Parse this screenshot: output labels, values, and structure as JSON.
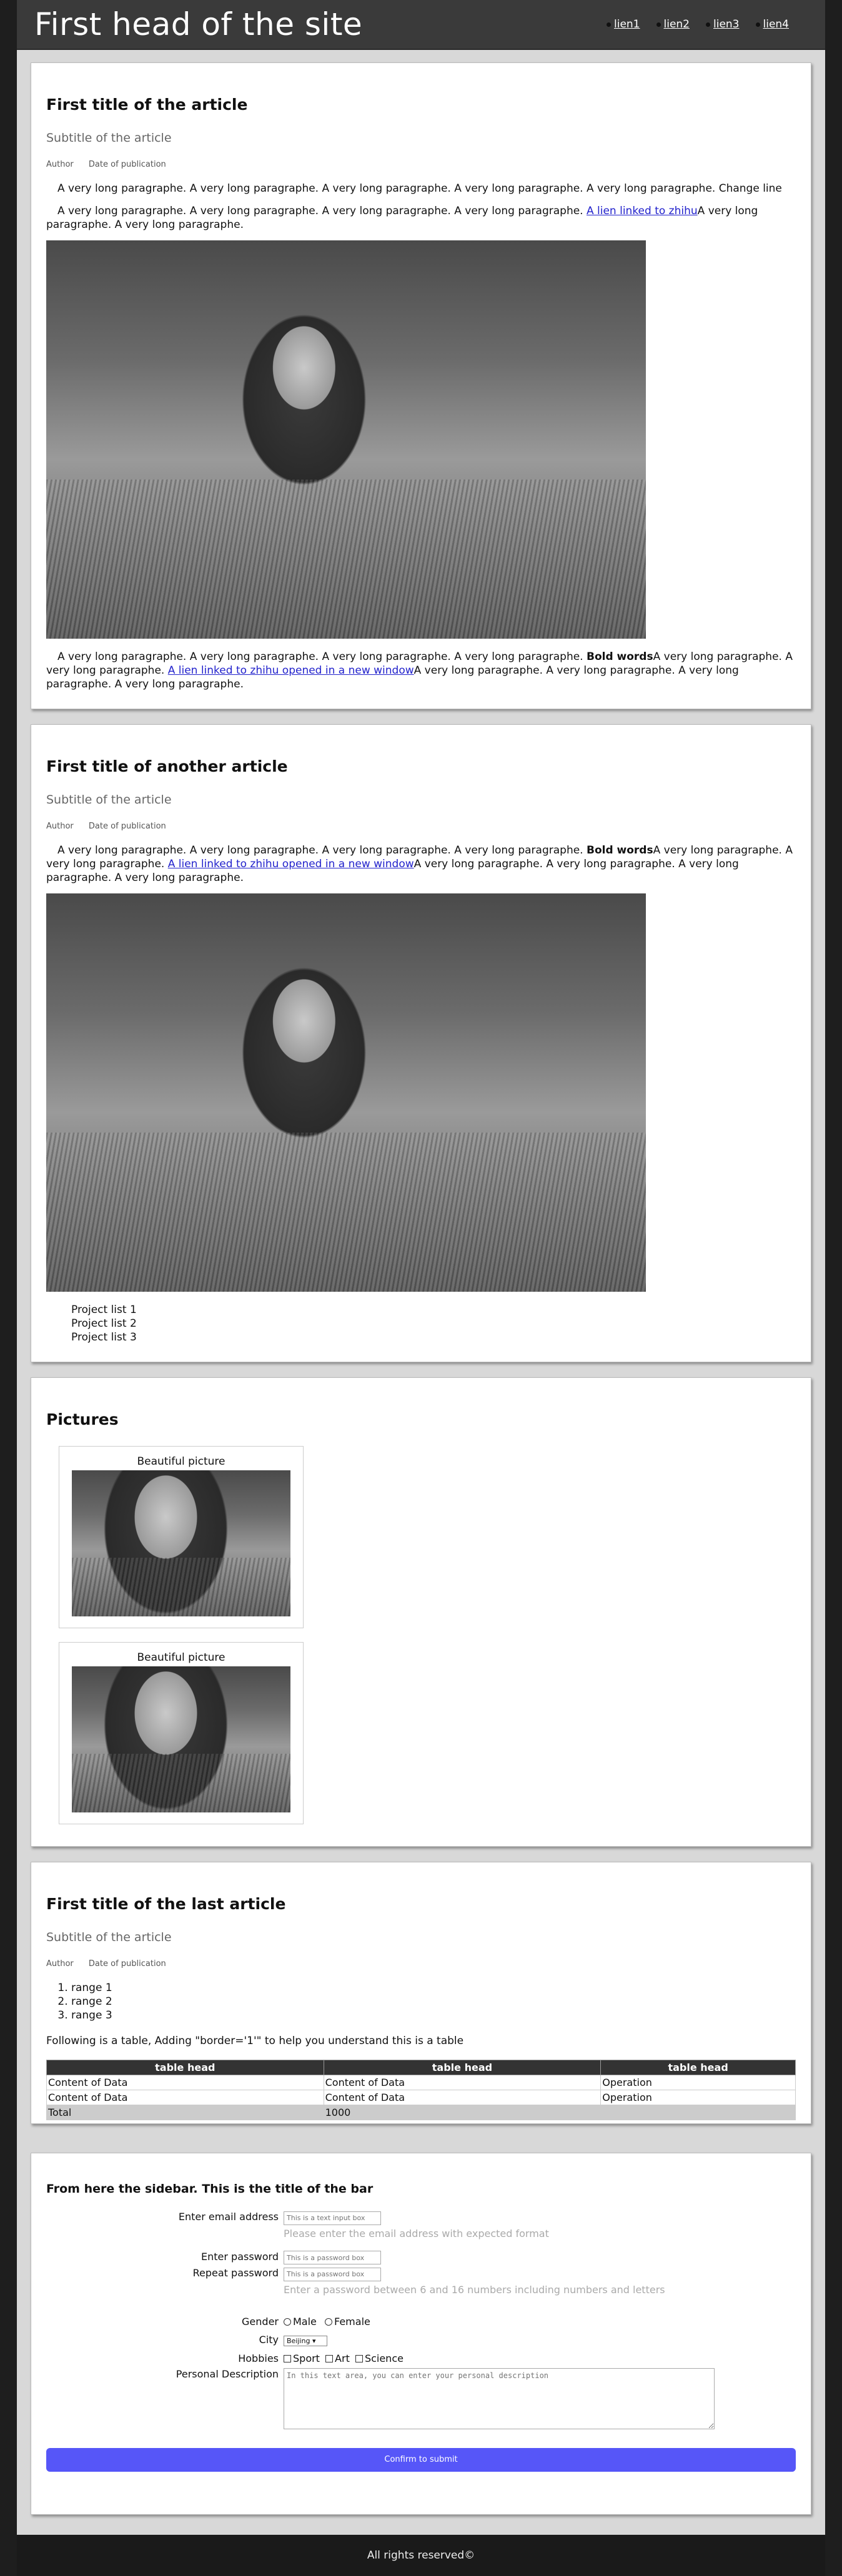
{
  "header": {
    "title": "First head of the site",
    "nav": [
      "lien1",
      "lien2",
      "lien3",
      "lien4"
    ]
  },
  "article1": {
    "title": "First title of the article",
    "subtitle": "Subtitle of the article",
    "author": "Author",
    "date": "Date of publication",
    "p1": "A very long paragraphe. A very long paragraphe. A very long paragraphe. A very long paragraphe. A very long paragraphe. Change line",
    "p2_a": "A very long paragraphe. A very long paragraphe. A very long paragraphe. A very long paragraphe. ",
    "p2_link": "A lien linked to zhihu",
    "p2_b": "A very long paragraphe. A very long paragraphe.",
    "p3_a": "A very long paragraphe. A very long paragraphe. A very long paragraphe. A very long paragraphe. ",
    "p3_bold": "Bold words",
    "p3_b": "A very long paragraphe. A very long paragraphe. ",
    "p3_link": "A lien linked to zhihu opened in a new window",
    "p3_c": "A very long paragraphe. A very long paragraphe. A very long paragraphe. A very long paragraphe."
  },
  "article2": {
    "title": "First title of another article",
    "subtitle": "Subtitle of the article",
    "author": "Author",
    "date": "Date of publication",
    "p1_a": "A very long paragraphe. A very long paragraphe. A very long paragraphe. A very long paragraphe. ",
    "p1_bold": "Bold words",
    "p1_b": "A very long paragraphe. A very long paragraphe. ",
    "p1_link": "A lien linked to zhihu opened in a new window",
    "p1_c": "A very long paragraphe. A very long paragraphe. A very long paragraphe. A very long paragraphe.",
    "list": [
      "Project list 1",
      "Project list 2",
      "Project list 3"
    ]
  },
  "pictures": {
    "title": "Pictures",
    "captions": [
      "Beautiful picture",
      "Beautiful picture"
    ]
  },
  "article3": {
    "title": "First title of the last article",
    "subtitle": "Subtitle of the article",
    "author": "Author",
    "date": "Date of publication",
    "ranges": [
      "range 1",
      "range 2",
      "range 3"
    ],
    "table_intro": "Following is a table, Adding \"border='1'\" to help you understand this is a table",
    "table": {
      "headers": [
        "table head",
        "table head",
        "table head"
      ],
      "rows": [
        [
          "Content of Data",
          "Content of Data",
          "Operation"
        ],
        [
          "Content of Data",
          "Content of Data",
          "Operation"
        ]
      ],
      "total": [
        "Total",
        "1000",
        ""
      ]
    }
  },
  "sidebar": {
    "title": "From here the sidebar. This is the title of the bar",
    "email_label": "Enter email address",
    "email_placeholder": "This is a text input box",
    "email_hint": "Please enter the email address with expected format",
    "password_label": "Enter password",
    "password_placeholder": "This is a password box",
    "repeat_label": "Repeat password",
    "repeat_placeholder": "This is a password box",
    "password_hint": "Enter a password between 6 and 16 numbers including numbers and letters",
    "gender_label": "Gender",
    "gender_options": [
      "Male",
      "Female"
    ],
    "city_label": "City",
    "city_value": "Beijing",
    "hobbies_label": "Hobbies",
    "hobby_options": [
      "Sport",
      "Art",
      "Science"
    ],
    "desc_label": "Personal Description",
    "desc_placeholder": "In this text area, you can enter your personal description",
    "submit_label": "Confirm to submit"
  },
  "footer": {
    "text": "All rights reserved©"
  }
}
